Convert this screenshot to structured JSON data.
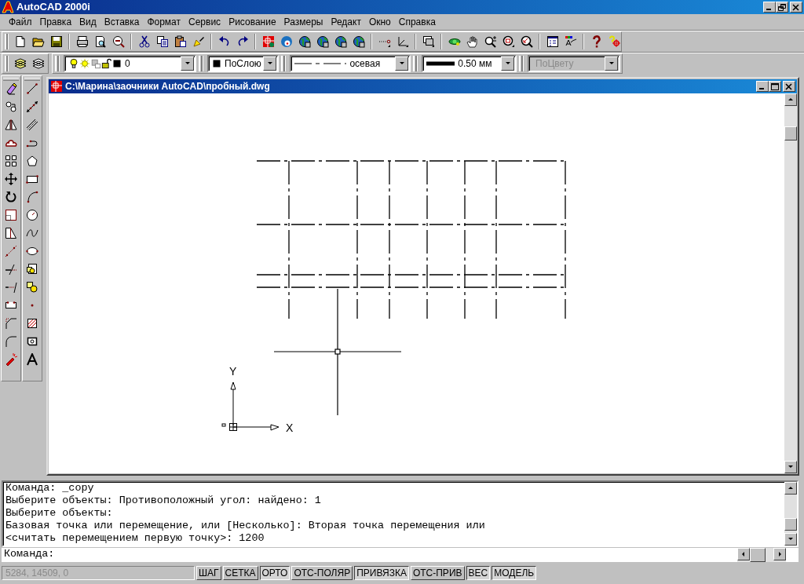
{
  "app": {
    "title": "AutoCAD 2000i"
  },
  "menu": [
    "Файл",
    "Правка",
    "Вид",
    "Вставка",
    "Формат",
    "Сервис",
    "Рисование",
    "Размеры",
    "Редакт",
    "Окно",
    "Справка"
  ],
  "properties_toolbar": {
    "layer": "0",
    "color_setting": "ПоСлою",
    "linetype": "осевая",
    "lineweight": "0.50 мм",
    "plot_style": {
      "value": "ПоЦвету",
      "disabled": true
    }
  },
  "document": {
    "title": "C:\\Марина\\заочники AutoCAD\\пробный.dwg",
    "ucs": {
      "x_label": "X",
      "y_label": "Y"
    }
  },
  "command_history": [
    "Команда: _copy",
    "Выберите объекты: Противоположный угол: найдено: 1",
    "Выберите объекты:",
    "Базовая точка или перемещение, или [Несколько]: Вторая точка перемещения или",
    "<считать перемещением первую точку>: 1200"
  ],
  "command_prompt": "Команда:",
  "status_bar": {
    "coordinates": {
      "value": "5284, 14509, 0",
      "disabled": true
    },
    "toggles": [
      {
        "label": "ШАГ",
        "on": false
      },
      {
        "label": "СЕТКА",
        "on": false
      },
      {
        "label": "ОРТО",
        "on": true
      },
      {
        "label": "ОТС-ПОЛЯР",
        "on": false
      },
      {
        "label": "ПРИВЯЗКА",
        "on": true
      },
      {
        "label": "ОТС-ПРИВ",
        "on": false
      },
      {
        "label": "ВЕС",
        "on": true
      },
      {
        "label": "МОДЕЛЬ",
        "on": true
      }
    ]
  }
}
